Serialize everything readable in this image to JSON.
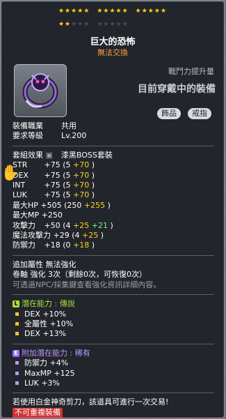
{
  "stars": {
    "row1_count": 15,
    "row2_filled": 2,
    "row2_empty": 8
  },
  "item": {
    "name": "巨大的恐怖",
    "trade": "無法交換",
    "power_label": "戰鬥力提升量",
    "equipped_label": "目前穿戴中的裝備",
    "tags": [
      "飾品",
      "戒指"
    ]
  },
  "info": {
    "job_label": "裝備職業",
    "job_value": "共用",
    "level_label": "要求等級",
    "level_value": "Lv.200",
    "set_label": "套組效果",
    "set_value": "漆黑BOSS套裝"
  },
  "stats": [
    {
      "name": "STR",
      "base": "+75",
      "open": "(5",
      "add": "+70",
      "close": ")"
    },
    {
      "name": "DEX",
      "base": "+75",
      "open": "(5",
      "add": "+70",
      "close": ")"
    },
    {
      "name": "INT",
      "base": "+75",
      "open": "(5",
      "add": "+70",
      "close": ")"
    },
    {
      "name": "LUK",
      "base": "+75",
      "open": "(5",
      "add": "+70",
      "close": ")"
    },
    {
      "name": "最大HP",
      "base": "+505",
      "open": "(250",
      "add": "+255",
      "close": ")"
    },
    {
      "name": "最大MP",
      "base": "+250",
      "open": "",
      "add": "",
      "close": ""
    },
    {
      "name": "攻擊力",
      "base": "+50",
      "open": "(4",
      "add": "+25",
      "extra": "+21",
      "close": ")"
    },
    {
      "name": "魔法攻擊力",
      "base": "+29",
      "open": "(4",
      "add": "+25",
      "close": ")"
    },
    {
      "name": "防禦力",
      "base": "+18",
      "open": "(0",
      "add": "+18",
      "close": ")"
    }
  ],
  "enhance": {
    "line1": "追加屬性 無法強化",
    "line2": "卷軸 強化 3次（剩餘0次，可恢復0次）",
    "line3": "可透過NPC/採集鍵查看強化資訊詳細內容。"
  },
  "potential": {
    "badge": "L",
    "header": "潛在能力 : 傳說",
    "lines": [
      "DEX +10%",
      "全屬性 +10%",
      "DEX +13%"
    ]
  },
  "additional": {
    "badge": "E",
    "header": "附加潛在能力 : 稀有",
    "lines": [
      "防禦力 +4%",
      "MaxMP +125",
      "LUK +3%"
    ]
  },
  "footer": {
    "scissor_note": "若使用白金神奇剪刀，該道具可進行一次交易!",
    "warning": "不可重複裝備"
  },
  "colors": {
    "star": "#ffd21a",
    "trade": "#ffa03c",
    "legend": "#a8e23c",
    "rare": "#b896ff",
    "bonus": "#ffd21a",
    "scroll": "#7ef07e"
  },
  "icons": {
    "item": "dark-ring-icon",
    "cursor": "ghost-cursor-icon"
  }
}
